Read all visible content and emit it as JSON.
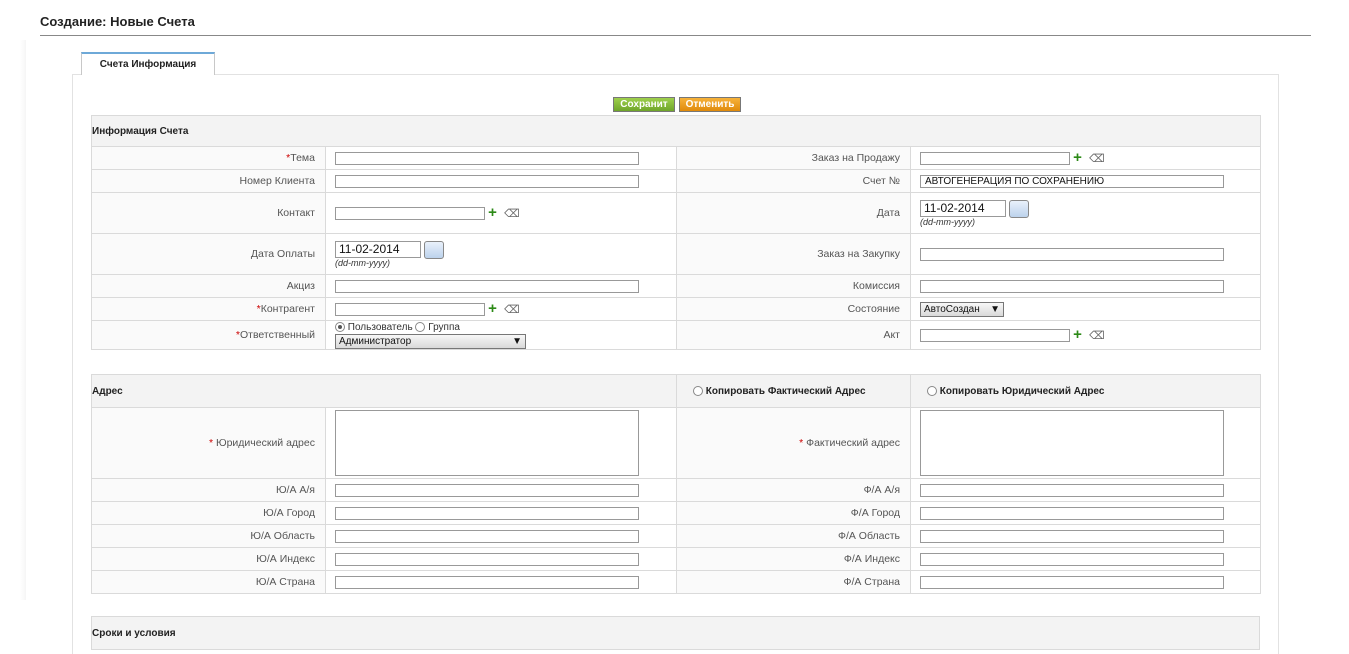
{
  "page_title": "Создание: Новые Счета",
  "tab_label": "Счета Информация",
  "buttons": {
    "save": "Сохранит",
    "cancel": "Отменить"
  },
  "info_section": {
    "title": "Информация Счета",
    "subject_label": "Тема",
    "client_no_label": "Номер Клиента",
    "contact_label": "Контакт",
    "pay_date_label": "Дата Оплаты",
    "pay_date_value": "11-02-2014",
    "date_format": "(dd-mm-yyyy)",
    "excise_label": "Акциз",
    "counterparty_label": "Контрагент",
    "responsible_label": "Ответственный",
    "owner_user": "Пользователь",
    "owner_group": "Группа",
    "owner_selected": "Администратор",
    "sales_order_label": "Заказ на Продажу",
    "invoice_no_label": "Счет №",
    "invoice_no_value": "АВТОГЕНЕРАЦИЯ ПО СОХРАНЕНИЮ",
    "date_label": "Дата",
    "date_value": "11-02-2014",
    "purchase_order_label": "Заказ на Закупку",
    "commission_label": "Комиссия",
    "status_label": "Состояние",
    "status_value": "АвтоСоздан",
    "act_label": "Акт"
  },
  "address_section": {
    "title": "Адрес",
    "copy_actual": "Копировать Фактический Адрес",
    "copy_legal": "Копировать Юридический Адрес",
    "legal_address": "Юридический адрес",
    "actual_address": "Фактический адрес",
    "legal_rows": [
      "Ю/А А/я",
      "Ю/А Город",
      "Ю/А Область",
      "Ю/А Индекс",
      "Ю/А Страна"
    ],
    "actual_rows": [
      "Ф/А А/я",
      "Ф/А Город",
      "Ф/А Область",
      "Ф/А Индекс",
      "Ф/А Страна"
    ]
  },
  "terms_section": {
    "title": "Сроки и условия"
  },
  "required_mark": "*",
  "dropdown_arrow": "▼"
}
